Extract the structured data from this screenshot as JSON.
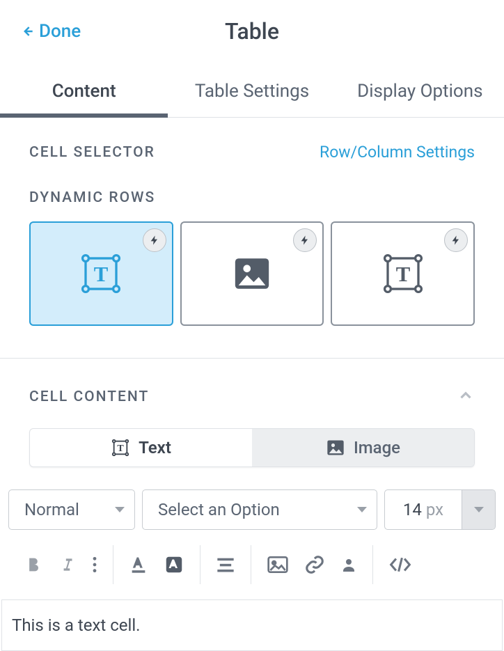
{
  "header": {
    "done_label": "Done",
    "title": "Table"
  },
  "tabs": {
    "items": [
      {
        "label": "Content",
        "active": true
      },
      {
        "label": "Table Settings",
        "active": false
      },
      {
        "label": "Display Options",
        "active": false
      }
    ]
  },
  "cell_selector": {
    "label": "CELL SELECTOR",
    "link": "Row/Column Settings"
  },
  "dynamic_rows": {
    "label": "DYNAMIC ROWS",
    "cards": [
      {
        "icon": "text-frame",
        "selected": true,
        "bolt": true
      },
      {
        "icon": "image",
        "selected": false,
        "bolt": true
      },
      {
        "icon": "text-frame",
        "selected": false,
        "bolt": true
      }
    ]
  },
  "cell_content": {
    "label": "CELL CONTENT",
    "segments": [
      {
        "label": "Text",
        "icon": "text-frame",
        "active": true
      },
      {
        "label": "Image",
        "icon": "image",
        "active": false
      }
    ]
  },
  "format": {
    "style_select": "Normal",
    "option_select_placeholder": "Select an Option",
    "font_size": "14",
    "font_size_unit": "px"
  },
  "editor": {
    "content": "This is a text cell."
  }
}
